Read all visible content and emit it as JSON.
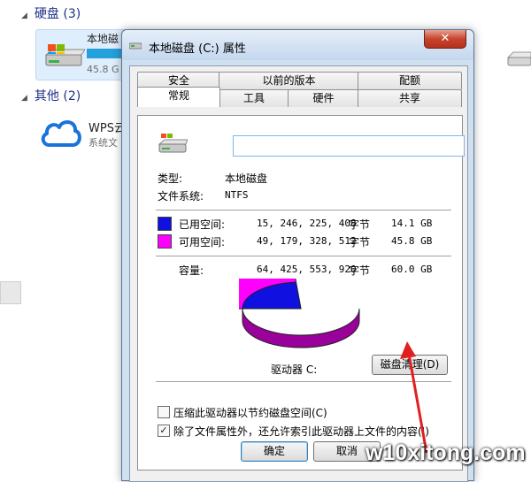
{
  "background": {
    "section_drives": "硬盘 (3)",
    "drive_name": "本地磁",
    "drive_size": "45.8 G",
    "section_other": "其他 (2)",
    "wps_name": "WPS云",
    "wps_sub": "系统文",
    "right_text": "···· ··"
  },
  "dialog": {
    "title": "本地磁盘 (C:) 属性",
    "close_glyph": "✕",
    "tabs_top": [
      "安全",
      "以前的版本",
      "配额"
    ],
    "tabs_bottom": [
      "常规",
      "工具",
      "硬件",
      "共享"
    ],
    "name_value": "",
    "type_label": "类型:",
    "type_value": "本地磁盘",
    "fs_label": "文件系统:",
    "fs_value": "NTFS",
    "used_label": "已用空间:",
    "used_bytes": "15, 246, 225, 408",
    "used_unit": "字节",
    "used_gb": "14.1 GB",
    "free_label": "可用空间:",
    "free_bytes": "49, 179, 328, 512",
    "free_unit": "字节",
    "free_gb": "45.8 GB",
    "capacity_label": "容量:",
    "capacity_bytes": "64, 425, 553, 920",
    "capacity_unit": "字节",
    "capacity_gb": "60.0 GB",
    "drive_label": "驱动器 C:",
    "cleanup_button": "磁盘清理(D)",
    "compress_label": "压缩此驱动器以节约磁盘空间(C)",
    "compress_checked": false,
    "index_label": "除了文件属性外，还允许索引此驱动器上文件的内容(I)",
    "index_checked": true,
    "ok_button": "确定",
    "cancel_button": "取消",
    "used_color": "#1010e0",
    "free_color": "#ff00ff",
    "used_fraction": 0.2367
  },
  "watermark": "w10xitong.com"
}
